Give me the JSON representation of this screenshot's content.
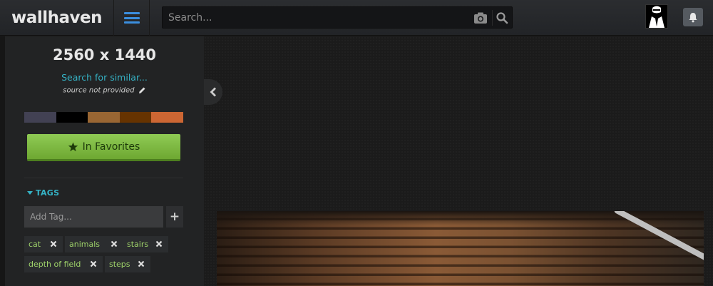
{
  "header": {
    "logo": "wallhaven",
    "search_placeholder": "Search..."
  },
  "sidebar": {
    "resolution": "2560 x 1440",
    "search_similar": "Search for similar...",
    "source": "source not provided",
    "palette": [
      "#424153",
      "#000000",
      "#996633",
      "#663300",
      "#cc6633"
    ],
    "favorite_label": "In Favorites",
    "tags_heading": "TAGS",
    "add_tag_placeholder": "Add Tag...",
    "add_tag_button": "+",
    "tags": [
      "cat",
      "animals",
      "stairs",
      "depth of field",
      "steps"
    ]
  },
  "colors": {
    "accent": "#35b3c6",
    "favorite_green": "#7fbc42",
    "tag_text": "#9fd36a",
    "menu_blue": "#3b8ede"
  }
}
